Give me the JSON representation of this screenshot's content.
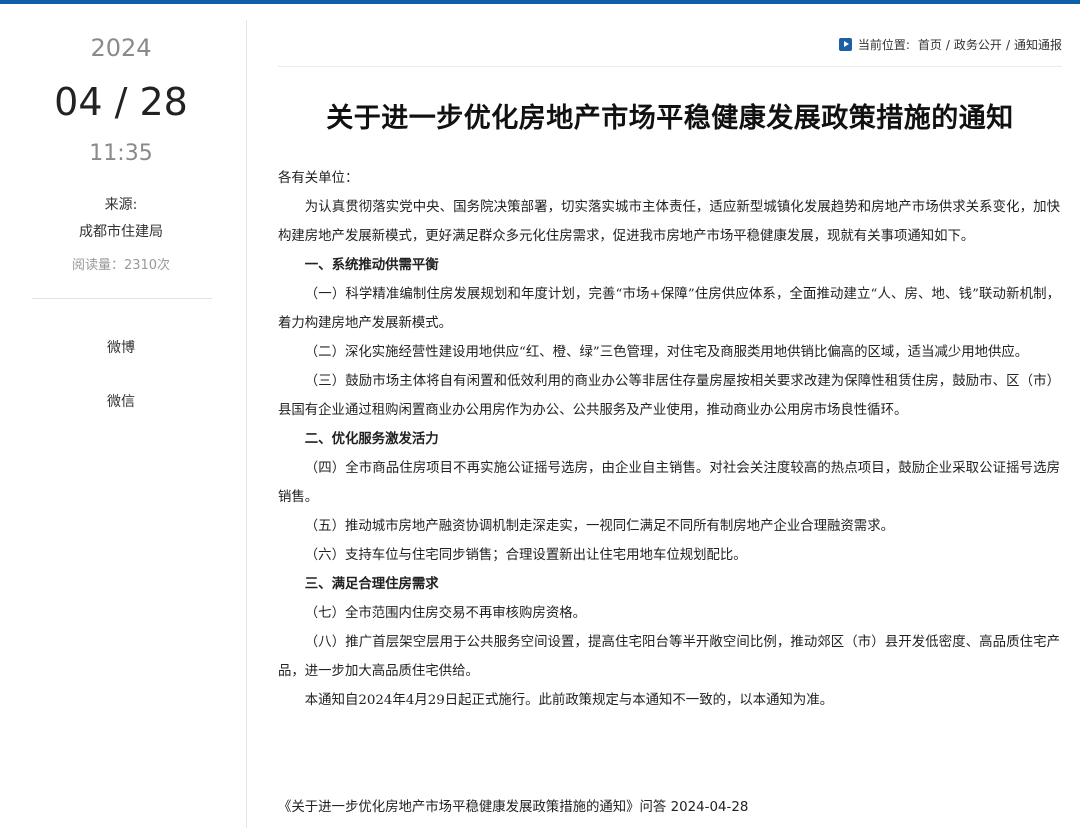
{
  "sidebar": {
    "year": "2024",
    "date": "04 / 28",
    "time": "11:35",
    "source_label": "来源:",
    "source_value": "成都市住建局",
    "reads": "阅读量：2310次",
    "share_weibo": "微博",
    "share_wechat": "微信"
  },
  "breadcrumb": {
    "label": "当前位置:",
    "home": "首页",
    "sep1": "/",
    "section": "政务公开",
    "sep2": "/",
    "current": "通知通报"
  },
  "article": {
    "title": "关于进一步优化房地产市场平稳健康发展政策措施的通知",
    "paragraphs": [
      {
        "type": "salutation",
        "text": "各有关单位："
      },
      {
        "type": "text",
        "text": "为认真贯彻落实党中央、国务院决策部署，切实落实城市主体责任，适应新型城镇化发展趋势和房地产市场供求关系变化，加快构建房地产发展新模式，更好满足群众多元化住房需求，促进我市房地产市场平稳健康发展，现就有关事项通知如下。"
      },
      {
        "type": "heading",
        "text": "一、系统推动供需平衡"
      },
      {
        "type": "text",
        "text": "（一）科学精准编制住房发展规划和年度计划，完善“市场+保障”住房供应体系，全面推动建立“人、房、地、钱”联动新机制，着力构建房地产发展新模式。"
      },
      {
        "type": "text",
        "text": "（二）深化实施经营性建设用地供应“红、橙、绿”三色管理，对住宅及商服类用地供销比偏高的区域，适当减少用地供应。"
      },
      {
        "type": "text",
        "text": "（三）鼓励市场主体将自有闲置和低效利用的商业办公等非居住存量房屋按相关要求改建为保障性租赁住房，鼓励市、区（市）县国有企业通过租购闲置商业办公用房作为办公、公共服务及产业使用，推动商业办公用房市场良性循环。"
      },
      {
        "type": "heading",
        "text": "二、优化服务激发活力"
      },
      {
        "type": "text",
        "text": "（四）全市商品住房项目不再实施公证摇号选房，由企业自主销售。对社会关注度较高的热点项目，鼓励企业采取公证摇号选房销售。"
      },
      {
        "type": "text",
        "text": "（五）推动城市房地产融资协调机制走深走实，一视同仁满足不同所有制房地产企业合理融资需求。"
      },
      {
        "type": "text",
        "text": "（六）支持车位与住宅同步销售；合理设置新出让住宅用地车位规划配比。"
      },
      {
        "type": "heading",
        "text": "三、满足合理住房需求"
      },
      {
        "type": "text",
        "text": "（七）全市范围内住房交易不再审核购房资格。"
      },
      {
        "type": "text",
        "text": "（八）推广首层架空层用于公共服务空间设置，提高住宅阳台等半开敞空间比例，推动郊区（市）县开发低密度、高品质住宅产品，进一步加大高品质住宅供给。"
      },
      {
        "type": "text",
        "text": "本通知自2024年4月29日起正式施行。此前政策规定与本通知不一致的，以本通知为准。"
      }
    ],
    "related_link": "《关于进一步优化房地产市场平稳健康发展政策措施的通知》问答 2024-04-28"
  },
  "colors": {
    "accent": "#0e5da8",
    "breadcrumb_icon": "#1b5fa6",
    "muted": "#8a8a8a"
  },
  "icons": {
    "breadcrumb": "play-square-icon"
  }
}
